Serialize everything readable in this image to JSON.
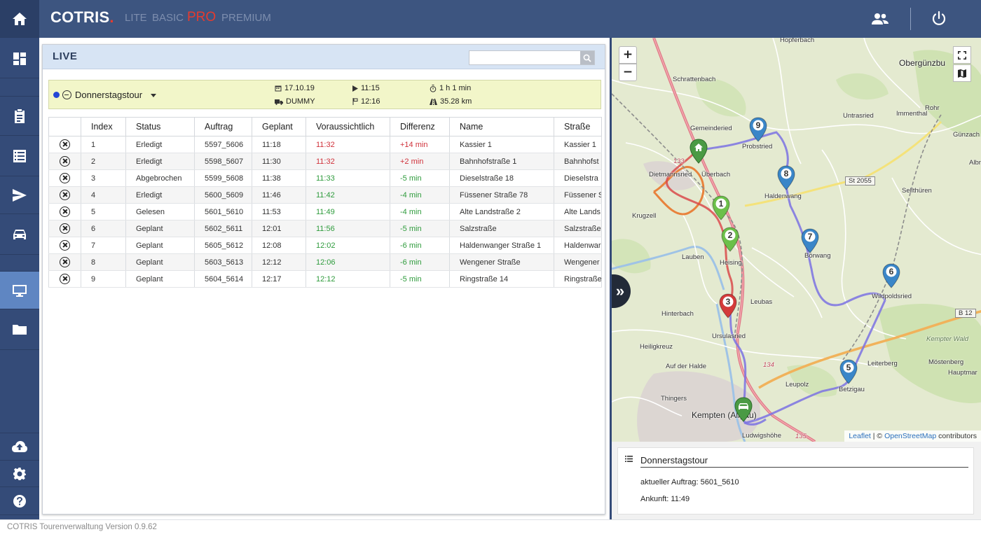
{
  "topbar": {
    "brand": "COTRIS",
    "brand_dot": ".",
    "plans": [
      "LITE",
      "BASIC",
      "PRO",
      "PREMIUM"
    ],
    "active_plan": "PRO",
    "icons": [
      "users-icon",
      "power-icon"
    ]
  },
  "sidebar": {
    "items": [
      {
        "icon": "home-icon"
      },
      {
        "icon": "dashboard-icon"
      },
      {
        "icon": "clipboard-icon"
      },
      {
        "icon": "list-icon"
      },
      {
        "icon": "send-icon"
      },
      {
        "icon": "car-icon"
      },
      {
        "icon": "monitor-icon",
        "active": true
      },
      {
        "icon": "folder-icon"
      },
      {
        "icon": "cloud-upload-icon"
      },
      {
        "icon": "settings-icon"
      },
      {
        "icon": "help-icon"
      }
    ]
  },
  "live": {
    "title": "LIVE",
    "search": {
      "value": "",
      "placeholder": ""
    }
  },
  "tour": {
    "name": "Donnerstagstour",
    "date": "17.10.19",
    "vehicle": "DUMMY",
    "start": "11:15",
    "end": "12:16",
    "duration": "1 h 1 min",
    "distance": "35.28 km"
  },
  "table": {
    "columns": [
      "",
      "Index",
      "Status",
      "Auftrag",
      "Geplant",
      "Voraussichtlich",
      "Differenz",
      "Name",
      "Straße"
    ],
    "rows": [
      {
        "index": "1",
        "status": "Erledigt",
        "auftrag": "5597_5606",
        "geplant": "11:18",
        "voraussichtlich": "11:32",
        "differenz": "+14 min",
        "name": "Kassier 1",
        "strasse": "Kassier 1",
        "trend": "late"
      },
      {
        "index": "2",
        "status": "Erledigt",
        "auftrag": "5598_5607",
        "geplant": "11:30",
        "voraussichtlich": "11:32",
        "differenz": "+2 min",
        "name": "Bahnhofstraße 1",
        "strasse": "Bahnhofst",
        "trend": "late"
      },
      {
        "index": "3",
        "status": "Abgebrochen",
        "auftrag": "5599_5608",
        "geplant": "11:38",
        "voraussichtlich": "11:33",
        "differenz": "-5 min",
        "name": "Dieselstraße 18",
        "strasse": "Dieselstra",
        "trend": "early"
      },
      {
        "index": "4",
        "status": "Erledigt",
        "auftrag": "5600_5609",
        "geplant": "11:46",
        "voraussichtlich": "11:42",
        "differenz": "-4 min",
        "name": "Füssener Straße 78",
        "strasse": "Füssener S",
        "trend": "early"
      },
      {
        "index": "5",
        "status": "Gelesen",
        "auftrag": "5601_5610",
        "geplant": "11:53",
        "voraussichtlich": "11:49",
        "differenz": "-4 min",
        "name": "Alte Landstraße 2",
        "strasse": "Alte Lands",
        "trend": "early"
      },
      {
        "index": "6",
        "status": "Geplant",
        "auftrag": "5602_5611",
        "geplant": "12:01",
        "voraussichtlich": "11:56",
        "differenz": "-5 min",
        "name": "Salzstraße",
        "strasse": "Salzstraße",
        "trend": "early"
      },
      {
        "index": "7",
        "status": "Geplant",
        "auftrag": "5605_5612",
        "geplant": "12:08",
        "voraussichtlich": "12:02",
        "differenz": "-6 min",
        "name": "Haldenwanger Straße 1",
        "strasse": "Haldenwar",
        "trend": "early"
      },
      {
        "index": "8",
        "status": "Geplant",
        "auftrag": "5603_5613",
        "geplant": "12:12",
        "voraussichtlich": "12:06",
        "differenz": "-6 min",
        "name": "Wengener Straße",
        "strasse": "Wengener",
        "trend": "early"
      },
      {
        "index": "9",
        "status": "Geplant",
        "auftrag": "5604_5614",
        "geplant": "12:17",
        "voraussichtlich": "12:12",
        "differenz": "-5 min",
        "name": "Ringstraße 14",
        "strasse": "Ringstraße",
        "trend": "early"
      }
    ]
  },
  "map": {
    "zoom_in": "+",
    "zoom_out": "−",
    "expand": "»",
    "places": [
      "Hopferbach",
      "Obergünzbu",
      "Schrattenbach",
      "Gemeinderied",
      "Probstried",
      "Untrasried",
      "Immenthal",
      "Rohr",
      "Günzach",
      "Albr",
      "Dietmannsried",
      "Überbach",
      "Haldenwang",
      "Sellthüren",
      "Krugzell",
      "Lauben",
      "Heising",
      "Börwang",
      "Wildpoldsried",
      "Hinterbach",
      "Leubas",
      "Ursulasried",
      "Heiligkreuz",
      "Kempter Wald",
      "Auf der Halde",
      "Leiterberg",
      "Möstenberg",
      "Hauptmar",
      "Leupolz",
      "Betzigau",
      "Thingers",
      "Kempten (Allgäu)",
      "Ludwigshöhe"
    ],
    "road_badges": [
      "St 2055",
      "B 12"
    ],
    "road_numbers": [
      "133",
      "134",
      "135"
    ],
    "markers": [
      {
        "label": "1",
        "color": "#6cc04a"
      },
      {
        "label": "2",
        "color": "#6cc04a"
      },
      {
        "label": "3",
        "color": "#d43a3a"
      },
      {
        "label": "5",
        "color": "#3a86c8"
      },
      {
        "label": "6",
        "color": "#3a86c8"
      },
      {
        "label": "7",
        "color": "#3a86c8"
      },
      {
        "label": "8",
        "color": "#3a86c8"
      },
      {
        "label": "9",
        "color": "#3a86c8"
      }
    ],
    "start_marker": "home-marker-icon",
    "vehicle_marker": "vehicle-marker-icon",
    "attribution": {
      "leaflet": "Leaflet",
      "sep": "| ©",
      "osm": "OpenStreetMap",
      "suffix": "contributors"
    }
  },
  "info": {
    "title": "Donnerstagstour",
    "current_order": "aktueller Auftrag: 5601_5610",
    "arrival": "Ankunft: 11:49"
  },
  "footer": {
    "text": "COTRIS Tourenverwaltung Version 0.9.62"
  },
  "colors": {
    "sidebar": "#344b78",
    "topbar": "#3d5580",
    "accent_red": "#e63b2e",
    "late": "#d0323b",
    "early": "#2e9b3c",
    "route": "#7b72e3",
    "tour_bar": "#f2f6c9"
  }
}
